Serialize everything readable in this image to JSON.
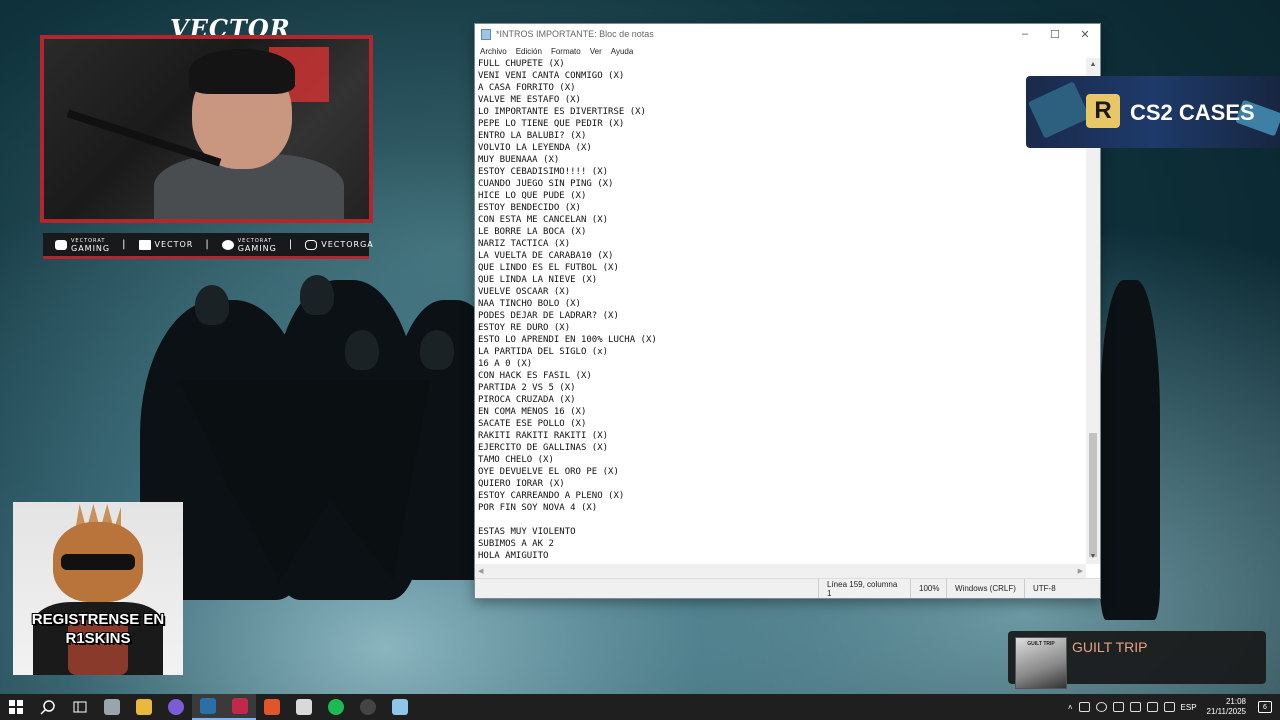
{
  "stream": {
    "cam_title": "VECTOR",
    "socials": [
      {
        "icon": "youtube-icon",
        "small": "VECTORAT",
        "label": "GAMING"
      },
      {
        "icon": "twitch-icon",
        "small": "",
        "label": "VECTOR"
      },
      {
        "icon": "twitter-icon",
        "small": "VECTORAT",
        "label": "GAMING"
      },
      {
        "icon": "instagram-icon",
        "small": "",
        "label": "VECTORGA"
      }
    ],
    "cs2_banner": {
      "logo": "R",
      "text": "CS2 CASES"
    },
    "promo_text": "REGISTRENSE EN R1SKINS",
    "now_playing": {
      "album_label": "GUILT TRIP",
      "song": "GUILT TRIP"
    }
  },
  "notepad": {
    "title": "*INTROS IMPORTANTE: Bloc de notas",
    "menu": [
      "Archivo",
      "Edición",
      "Formato",
      "Ver",
      "Ayuda"
    ],
    "lines": [
      "FULL CHUPETE (X)",
      "VENI VENI CANTA CONMIGO (X)",
      "A CASA FORRITO (X)",
      "VALVE ME ESTAFO (X)",
      "LO IMPORTANTE ES DIVERTIRSE (X)",
      "PEPE LO TIENE QUE PEDIR (X)",
      "ENTRO LA BALUBI? (X)",
      "VOLVIO LA LEYENDA (X)",
      "MUY BUENAAA (X)",
      "ESTOY CEBADISIMO!!!! (X)",
      "CUANDO JUEGO SIN PING (X)",
      "HICE LO QUE PUDE (X)",
      "ESTOY BENDECIDO (X)",
      "CON ESTA ME CANCELAN (X)",
      "LE BORRE LA BOCA (X)",
      "NARIZ TACTICA (X)",
      "LA VUELTA DE CARABA10 (X)",
      "QUE LINDO ES EL FUTBOL (X)",
      "QUE LINDA LA NIEVE (X)",
      "VUELVE OSCAAR (X)",
      "NAA TINCHO BOLO (X)",
      "PODES DEJAR DE LADRAR? (X)",
      "ESTOY RE DURO (X)",
      "ESTO LO APRENDI EN 100% LUCHA (X)",
      "LA PARTIDA DEL SIGLO (x)",
      "16 A 0 (X)",
      "CON HACK ES FASIL (X)",
      "PARTIDA 2 VS 5 (X)",
      "PIROCA CRUZADA (X)",
      "EN COMA MENOS 16 (X)",
      "SACATE ESE POLLO (X)",
      "RAKITI RAKITI RAKITI (X)",
      "EJERCITO DE GALLINAS (X)",
      "TAMO CHELO (X)",
      "OYE DEVUELVE EL ORO PE (X)",
      "QUIERO IORAR (X)",
      "ESTOY CARREANDO A PLENO (X)",
      "POR FIN SOY NOVA 4 (X)",
      "",
      "ESTAS MUY VIOLENTO",
      "SUBIMOS A AK 2",
      "HOLA AMIGUITO"
    ],
    "status": {
      "position": "Línea 159, columna 1",
      "zoom": "100%",
      "line_ending": "Windows (CRLF)",
      "encoding": "UTF-8"
    }
  },
  "taskbar": {
    "apps": [
      {
        "name": "file-explorer-window",
        "color": "#9aa4ad"
      },
      {
        "name": "file-explorer",
        "color": "#e8b93a"
      },
      {
        "name": "discord",
        "color": "#7a5cd6"
      },
      {
        "name": "steam",
        "color": "#2a6fa8"
      },
      {
        "name": "opera-gx",
        "color": "#c02a4a"
      },
      {
        "name": "brave",
        "color": "#e0562a"
      },
      {
        "name": "counter-strike",
        "color": "#d9d9d9"
      },
      {
        "name": "spotify",
        "color": "#1db954"
      },
      {
        "name": "obs",
        "color": "#444"
      },
      {
        "name": "notepad",
        "color": "#8fc6e8"
      }
    ],
    "language": "ESP",
    "time": "21:08",
    "date": "21/11/2025",
    "notifications": "6"
  }
}
